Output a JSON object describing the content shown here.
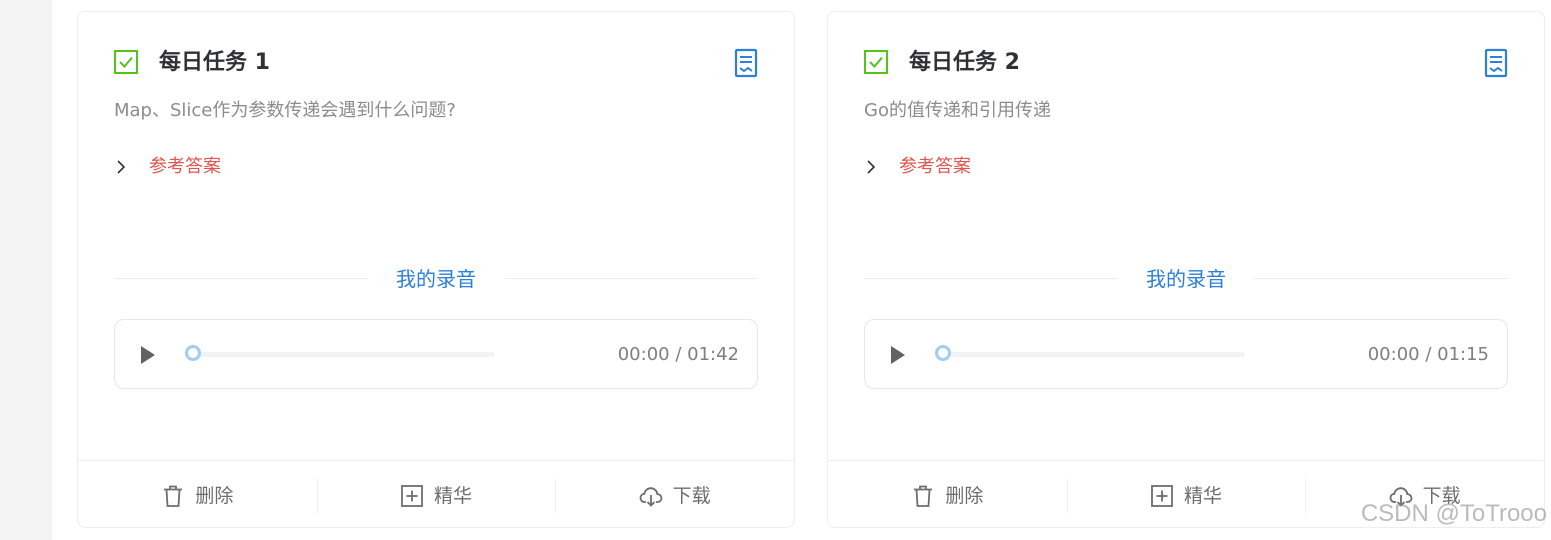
{
  "colors": {
    "check_green": "#52c41a",
    "accent_blue": "#2d7fd8",
    "answer_red": "#e0564f",
    "knob_blue": "#9ecdf6"
  },
  "cards": [
    {
      "title": "每日任务 1",
      "question": "Map、Slice作为参数传递会遇到什么问题?",
      "answer_label": "参考答案",
      "recording_title": "我的录音",
      "player": {
        "time": "00:00 / 01:42",
        "progress": 0
      },
      "actions": {
        "delete": "删除",
        "featured": "精华",
        "download": "下载"
      },
      "icons": {
        "check": "checkbox-checked-icon",
        "doc": "document-icon",
        "chevron": "chevron-right-icon",
        "play": "play-icon",
        "delete": "trash-icon",
        "featured": "plus-square-icon",
        "download": "cloud-download-icon"
      }
    },
    {
      "title": "每日任务 2",
      "question": "Go的值传递和引用传递",
      "answer_label": "参考答案",
      "recording_title": "我的录音",
      "player": {
        "time": "00:00 / 01:15",
        "progress": 0
      },
      "actions": {
        "delete": "删除",
        "featured": "精华",
        "download": "下载"
      },
      "icons": {
        "check": "checkbox-checked-icon",
        "doc": "document-icon",
        "chevron": "chevron-right-icon",
        "play": "play-icon",
        "delete": "trash-icon",
        "featured": "plus-square-icon",
        "download": "cloud-download-icon"
      }
    }
  ],
  "watermark": "CSDN @ToTrooo"
}
